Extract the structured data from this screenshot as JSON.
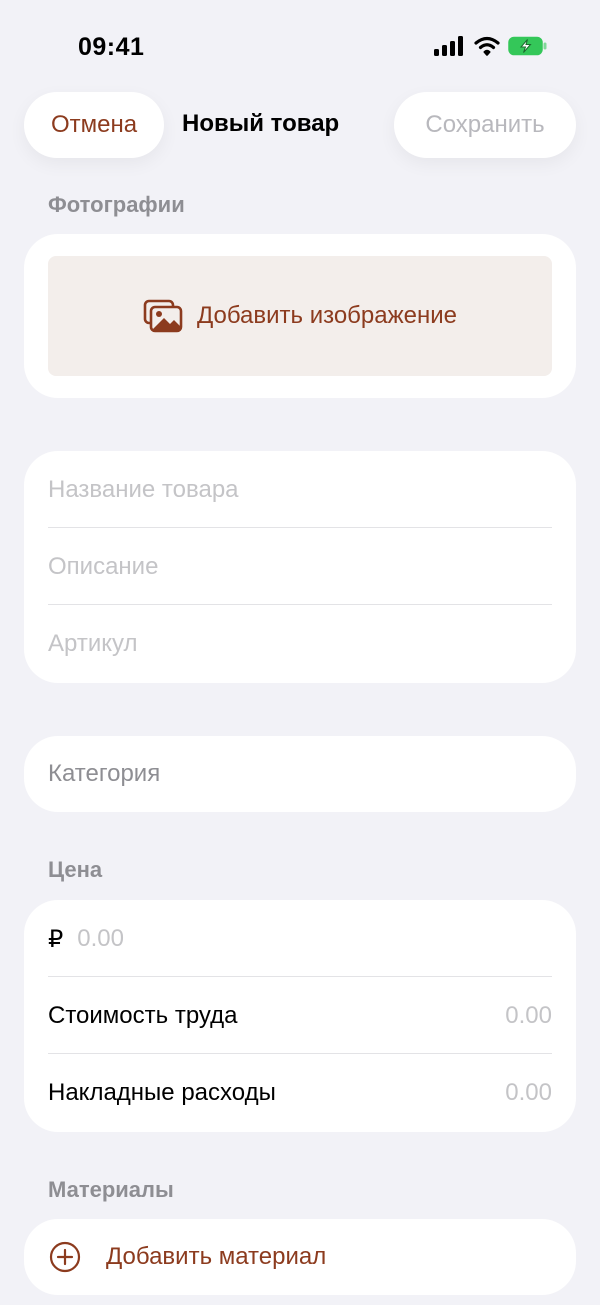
{
  "status_bar": {
    "time": "09:41"
  },
  "nav": {
    "cancel_label": "Отмена",
    "title": "Новый товар",
    "save_label": "Сохранить"
  },
  "photos": {
    "section_title": "Фотографии",
    "add_label": "Добавить изображение"
  },
  "info": {
    "name_placeholder": "Название товара",
    "description_placeholder": "Описание",
    "sku_placeholder": "Артикул"
  },
  "category": {
    "label": "Категория"
  },
  "price": {
    "section_title": "Цена",
    "currency_symbol": "₽",
    "price_placeholder": "0.00",
    "labor_label": "Стоимость труда",
    "labor_value": "0.00",
    "overhead_label": "Накладные расходы",
    "overhead_value": "0.00"
  },
  "materials": {
    "section_title": "Материалы",
    "add_label": "Добавить материал"
  },
  "colors": {
    "accent": "#8c3b1e",
    "background": "#f2f2f7",
    "battery": "#34c759"
  }
}
